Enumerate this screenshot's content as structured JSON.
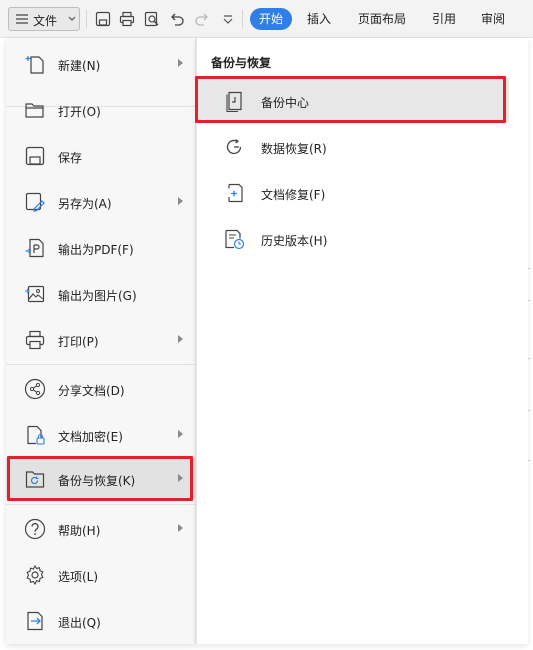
{
  "toolbar": {
    "file_label": "文件",
    "icons": [
      "menu-icon",
      "save-icon",
      "print-icon",
      "print-preview-icon",
      "undo-icon",
      "redo-icon",
      "more-icon"
    ],
    "tabs": [
      {
        "label": "开始",
        "active": true
      },
      {
        "label": "插入"
      },
      {
        "label": "页面布局"
      },
      {
        "label": "引用"
      },
      {
        "label": "审阅"
      }
    ]
  },
  "menu": {
    "items": [
      {
        "label": "新建(N)",
        "icon": "new-doc-icon",
        "submenu": true
      },
      {
        "label": "打开(O)",
        "icon": "folder-open-icon",
        "submenu": false
      },
      {
        "label": "保存",
        "icon": "save-icon",
        "submenu": false
      },
      {
        "label": "另存为(A)",
        "icon": "save-as-icon",
        "submenu": true
      },
      {
        "label": "输出为PDF(F)",
        "icon": "export-pdf-icon",
        "submenu": false
      },
      {
        "label": "输出为图片(G)",
        "icon": "export-image-icon",
        "submenu": false
      },
      {
        "label": "打印(P)",
        "icon": "print-icon",
        "submenu": true
      },
      {
        "label": "分享文档(D)",
        "icon": "share-icon",
        "submenu": false
      },
      {
        "label": "文档加密(E)",
        "icon": "encrypt-icon",
        "submenu": true
      },
      {
        "label": "备份与恢复(K)",
        "icon": "backup-restore-icon",
        "submenu": true,
        "selected": true
      },
      {
        "label": "帮助(H)",
        "icon": "help-icon",
        "submenu": true
      },
      {
        "label": "选项(L)",
        "icon": "gear-icon",
        "submenu": false
      },
      {
        "label": "退出(Q)",
        "icon": "exit-icon",
        "submenu": false
      }
    ]
  },
  "submenu": {
    "title": "备份与恢复",
    "items": [
      {
        "label": "备份中心",
        "icon": "backup-center-icon",
        "hover": true
      },
      {
        "label": "数据恢复(R)",
        "icon": "data-recovery-icon"
      },
      {
        "label": "文档修复(F)",
        "icon": "doc-repair-icon"
      },
      {
        "label": "历史版本(H)",
        "icon": "history-version-icon"
      }
    ]
  },
  "colors": {
    "accent": "#2f7fe6",
    "highlight": "#e0222b",
    "menu_bg": "#f7f7f7",
    "selected_bg": "#e2e2e2"
  }
}
